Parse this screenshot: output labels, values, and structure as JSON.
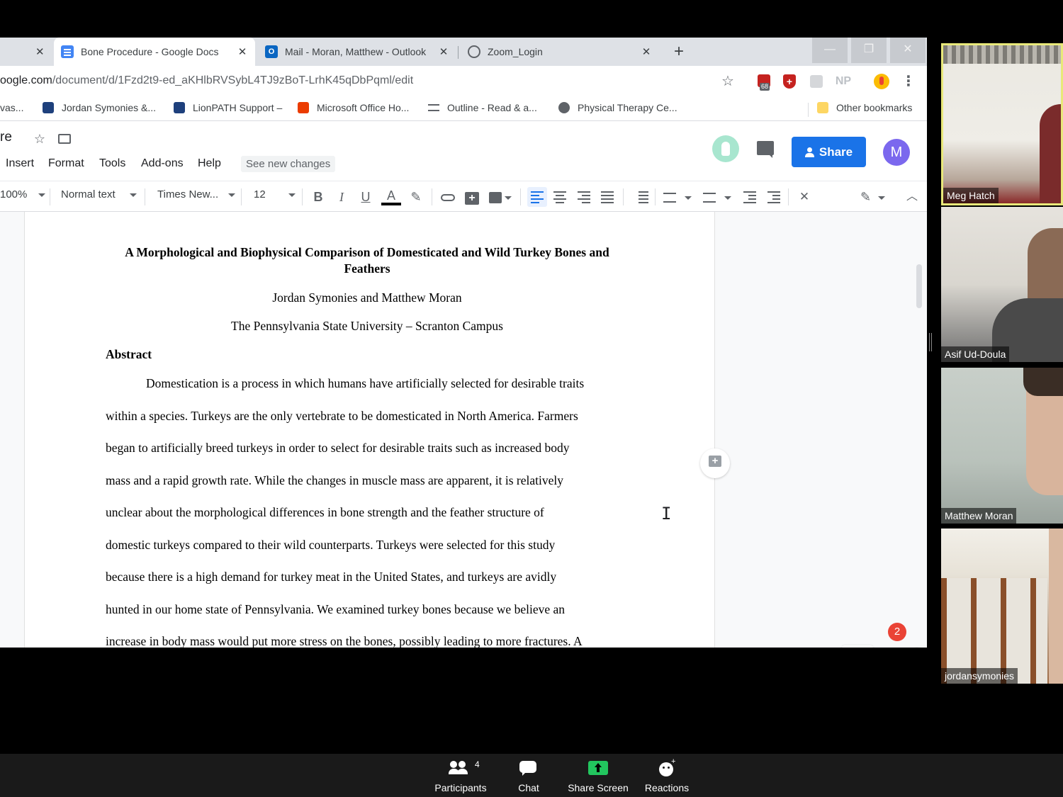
{
  "browser": {
    "tabs": [
      {
        "title": "Bone Procedure - Google Docs",
        "close": "✕"
      },
      {
        "title": "Mail - Moran, Matthew - Outlook",
        "close": "✕"
      },
      {
        "title": "Zoom_Login",
        "close": "✕"
      }
    ],
    "first_tab_close": "✕",
    "new_tab": "+",
    "window_controls": {
      "minimize": "—",
      "restore": "❐",
      "close": "✕"
    },
    "url_host": "oogle.com",
    "url_path": "/document/d/1Fzd2t9-ed_aKHlbRVSybL4TJ9zBoT-LrhK45qDbPqml/edit",
    "extension_badge": "68",
    "extension_np": "NP",
    "menu_dots": "⋮",
    "star": "☆",
    "bookmarks": [
      {
        "label": "vas..."
      },
      {
        "label": "Jordan Symonies &..."
      },
      {
        "label": "LionPATH Support –"
      },
      {
        "label": "Microsoft Office Ho..."
      },
      {
        "label": "Outline - Read & a..."
      },
      {
        "label": "Physical Therapy Ce..."
      }
    ],
    "other_bookmarks": "Other bookmarks"
  },
  "docs": {
    "title_fragment": "re",
    "menu": [
      "Insert",
      "Format",
      "Tools",
      "Add-ons",
      "Help"
    ],
    "see_new_changes": "See new changes",
    "share_label": "Share",
    "avatar_initial": "M",
    "toolbar": {
      "zoom": "100%",
      "style": "Normal text",
      "font": "Times New...",
      "size": "12",
      "bold": "B",
      "italic": "I",
      "underline": "U",
      "text_color": "A"
    },
    "document": {
      "heading": "A Morphological and Biophysical Comparison of Domesticated and Wild Turkey Bones and Feathers",
      "authors": "Jordan Symonies and Matthew Moran",
      "institution": "The Pennsylvania State University – Scranton Campus",
      "abstract_heading": "Abstract",
      "abstract_lines": [
        "Domestication is a process in which humans have artificially selected for desirable traits",
        "within a species. Turkeys are the only vertebrate to be domesticated in North America. Farmers",
        "began to artificially breed turkeys in order to select for desirable traits such as increased body",
        "mass and a rapid growth rate. While the changes in muscle mass are apparent, it is relatively",
        "unclear about the morphological differences in bone strength and the feather structure of",
        "domestic turkeys compared to their wild counterparts. Turkeys were selected for this study",
        "because there is a high demand for turkey meat in the United States, and turkeys are avidly",
        "hunted in our home state of Pennsylvania. We examined turkey bones because we believe an",
        "increase in body mass would put more stress on the bones, possibly leading to more fractures. A"
      ]
    },
    "explore_badge": "2"
  },
  "zoom": {
    "participants": [
      {
        "name": "Meg Hatch"
      },
      {
        "name": "Asif Ud-Doula"
      },
      {
        "name": "Matthew Moran"
      },
      {
        "name": "jordansymonies"
      }
    ],
    "controls": {
      "participants_label": "Participants",
      "participants_count": "4",
      "chat_label": "Chat",
      "share_label": "Share Screen",
      "reactions_label": "Reactions"
    },
    "colors": {
      "active_speaker_border": "#e8e87a",
      "share_green": "#22c55e"
    }
  }
}
